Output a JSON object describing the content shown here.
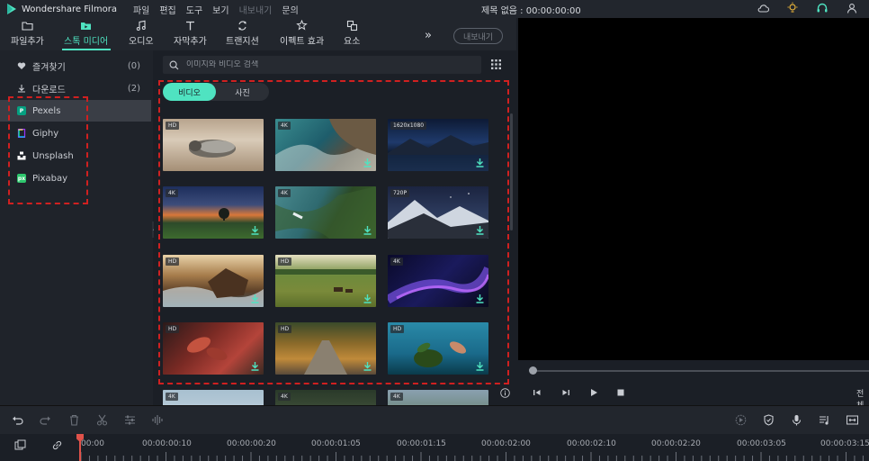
{
  "app": {
    "name": "Wondershare Filmora",
    "project_title": "제목 없음 : 00:00:00:00",
    "menu": [
      "파일",
      "편집",
      "도구",
      "보기",
      "내보내기",
      "문의"
    ],
    "menu_disabled_index": 4
  },
  "toolbar": {
    "tools": [
      {
        "label": "파일추가",
        "icon": "folder-icon"
      },
      {
        "label": "스톡 미디어",
        "icon": "stock-media-icon",
        "active": true
      },
      {
        "label": "오디오",
        "icon": "music-note-icon"
      },
      {
        "label": "자막추가",
        "icon": "text-icon"
      },
      {
        "label": "트랜지션",
        "icon": "transition-icon"
      },
      {
        "label": "이펙트 효과",
        "icon": "effects-icon"
      },
      {
        "label": "요소",
        "icon": "elements-icon"
      }
    ],
    "more": "»",
    "export_label": "내보내기"
  },
  "sidebar": {
    "items": [
      {
        "label": "즐겨찾기",
        "count": "(0)",
        "icon": "heart-icon"
      },
      {
        "label": "다운로드",
        "count": "(2)",
        "icon": "download-icon"
      },
      {
        "label": "Pexels",
        "icon": "pexels-icon",
        "selected": true,
        "badge": "P",
        "color": "#05a081"
      },
      {
        "label": "Giphy",
        "icon": "giphy-icon",
        "badge": "",
        "color": "#9933ff"
      },
      {
        "label": "Unsplash",
        "icon": "unsplash-icon",
        "badge": "",
        "color": "#ffffff"
      },
      {
        "label": "Pixabay",
        "icon": "pixabay-icon",
        "badge": "px",
        "color": "#2ec66d"
      }
    ]
  },
  "media": {
    "search_placeholder": "이미지와 비디오 검색",
    "tabs": [
      {
        "label": "비디오",
        "active": true
      },
      {
        "label": "사진",
        "active": false
      }
    ],
    "thumbnails": [
      {
        "badge": "HD",
        "scene": "seal-on-beach",
        "download": false
      },
      {
        "badge": "4K",
        "scene": "aerial-coast",
        "download": true
      },
      {
        "badge": "1620x1080",
        "scene": "mountain-lake-night",
        "download": true
      },
      {
        "badge": "4K",
        "scene": "sunset-tree",
        "download": true
      },
      {
        "badge": "4K",
        "scene": "aerial-river-forest",
        "download": true
      },
      {
        "badge": "720P",
        "scene": "starry-mountains",
        "download": true
      },
      {
        "badge": "HD",
        "scene": "rocky-waves",
        "download": true
      },
      {
        "badge": "HD",
        "scene": "horses-field",
        "download": true
      },
      {
        "badge": "4K",
        "scene": "purple-particles",
        "download": true
      },
      {
        "badge": "HD",
        "scene": "red-leaves",
        "download": true
      },
      {
        "badge": "HD",
        "scene": "autumn-road",
        "download": true
      },
      {
        "badge": "HD",
        "scene": "plant-underwater",
        "download": true
      },
      {
        "badge": "4K",
        "scene": "partial-1",
        "download": false
      },
      {
        "badge": "4K",
        "scene": "partial-2",
        "download": false
      },
      {
        "badge": "4K",
        "scene": "partial-3",
        "download": false
      }
    ]
  },
  "preview": {
    "fullscreen_label": "전체",
    "progress": 0
  },
  "timeline": {
    "timestamps": [
      "00:00",
      "00:00:00:10",
      "00:00:00:20",
      "00:00:01:05",
      "00:00:01:15",
      "00:00:02:00",
      "00:00:02:10",
      "00:00:02:20",
      "00:00:03:05",
      "00:00:03:15"
    ]
  },
  "colors": {
    "accent": "#4fe3c1",
    "highlight_box": "#d02020"
  }
}
